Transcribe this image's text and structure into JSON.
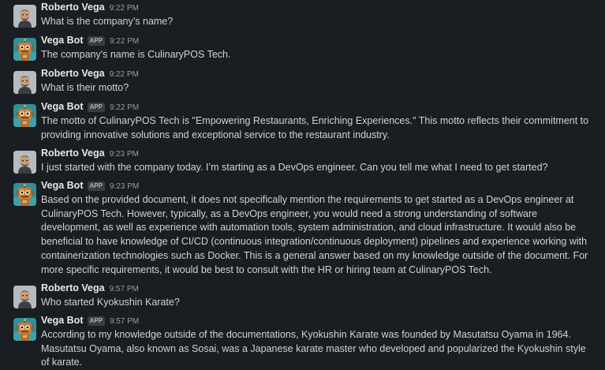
{
  "messages": [
    {
      "author": "Roberto Vega",
      "is_app": false,
      "time": "9:22 PM",
      "text": "What is the company’s name?"
    },
    {
      "author": "Vega Bot",
      "is_app": true,
      "app_badge": "APP",
      "time": "9:22 PM",
      "text": "The company's name is CulinaryPOS Tech."
    },
    {
      "author": "Roberto Vega",
      "is_app": false,
      "time": "9:22 PM",
      "text": "What is their motto?"
    },
    {
      "author": "Vega Bot",
      "is_app": true,
      "app_badge": "APP",
      "time": "9:22 PM",
      "text": "The motto of CulinaryPOS Tech is \"Empowering Restaurants, Enriching Experiences.\" This motto reflects their commitment to providing innovative solutions and exceptional service to the restaurant industry."
    },
    {
      "author": "Roberto Vega",
      "is_app": false,
      "time": "9:23 PM",
      "text": "I just started with the company today. I’m starting as a DevOps engineer. Can you tell me what I need to get started?"
    },
    {
      "author": "Vega Bot",
      "is_app": true,
      "app_badge": "APP",
      "time": "9:23 PM",
      "text": "Based on the provided document, it does not specifically mention the requirements to get started as a DevOps engineer at CulinaryPOS Tech. However, typically, as a DevOps engineer, you would need a strong understanding of software development, as well as experience with automation tools, system administration, and cloud infrastructure. It would also be beneficial to have knowledge of CI/CD (continuous integration/continuous deployment) pipelines and experience working with containerization technologies such as Docker. This is a general answer based on my knowledge outside of the document. For more specific requirements, it would be best to consult with the HR or hiring team at CulinaryPOS Tech."
    },
    {
      "author": "Roberto Vega",
      "is_app": false,
      "time": "9:57 PM",
      "text": "Who started Kyokushin Karate?"
    },
    {
      "author": "Vega Bot",
      "is_app": true,
      "app_badge": "APP",
      "time": "9:57 PM",
      "text": "According to my knowledge outside of the documentations, Kyokushin Karate was founded by Masutatsu Oyama in 1964. Masutatsu Oyama, also known as Sosai, was a Japanese karate master who developed and popularized the Kyokushin style of karate."
    }
  ],
  "colors": {
    "background": "#1a1d21",
    "text": "#d1d2d3",
    "name": "#e8e8e8",
    "timestamp": "#9a9b9d"
  }
}
